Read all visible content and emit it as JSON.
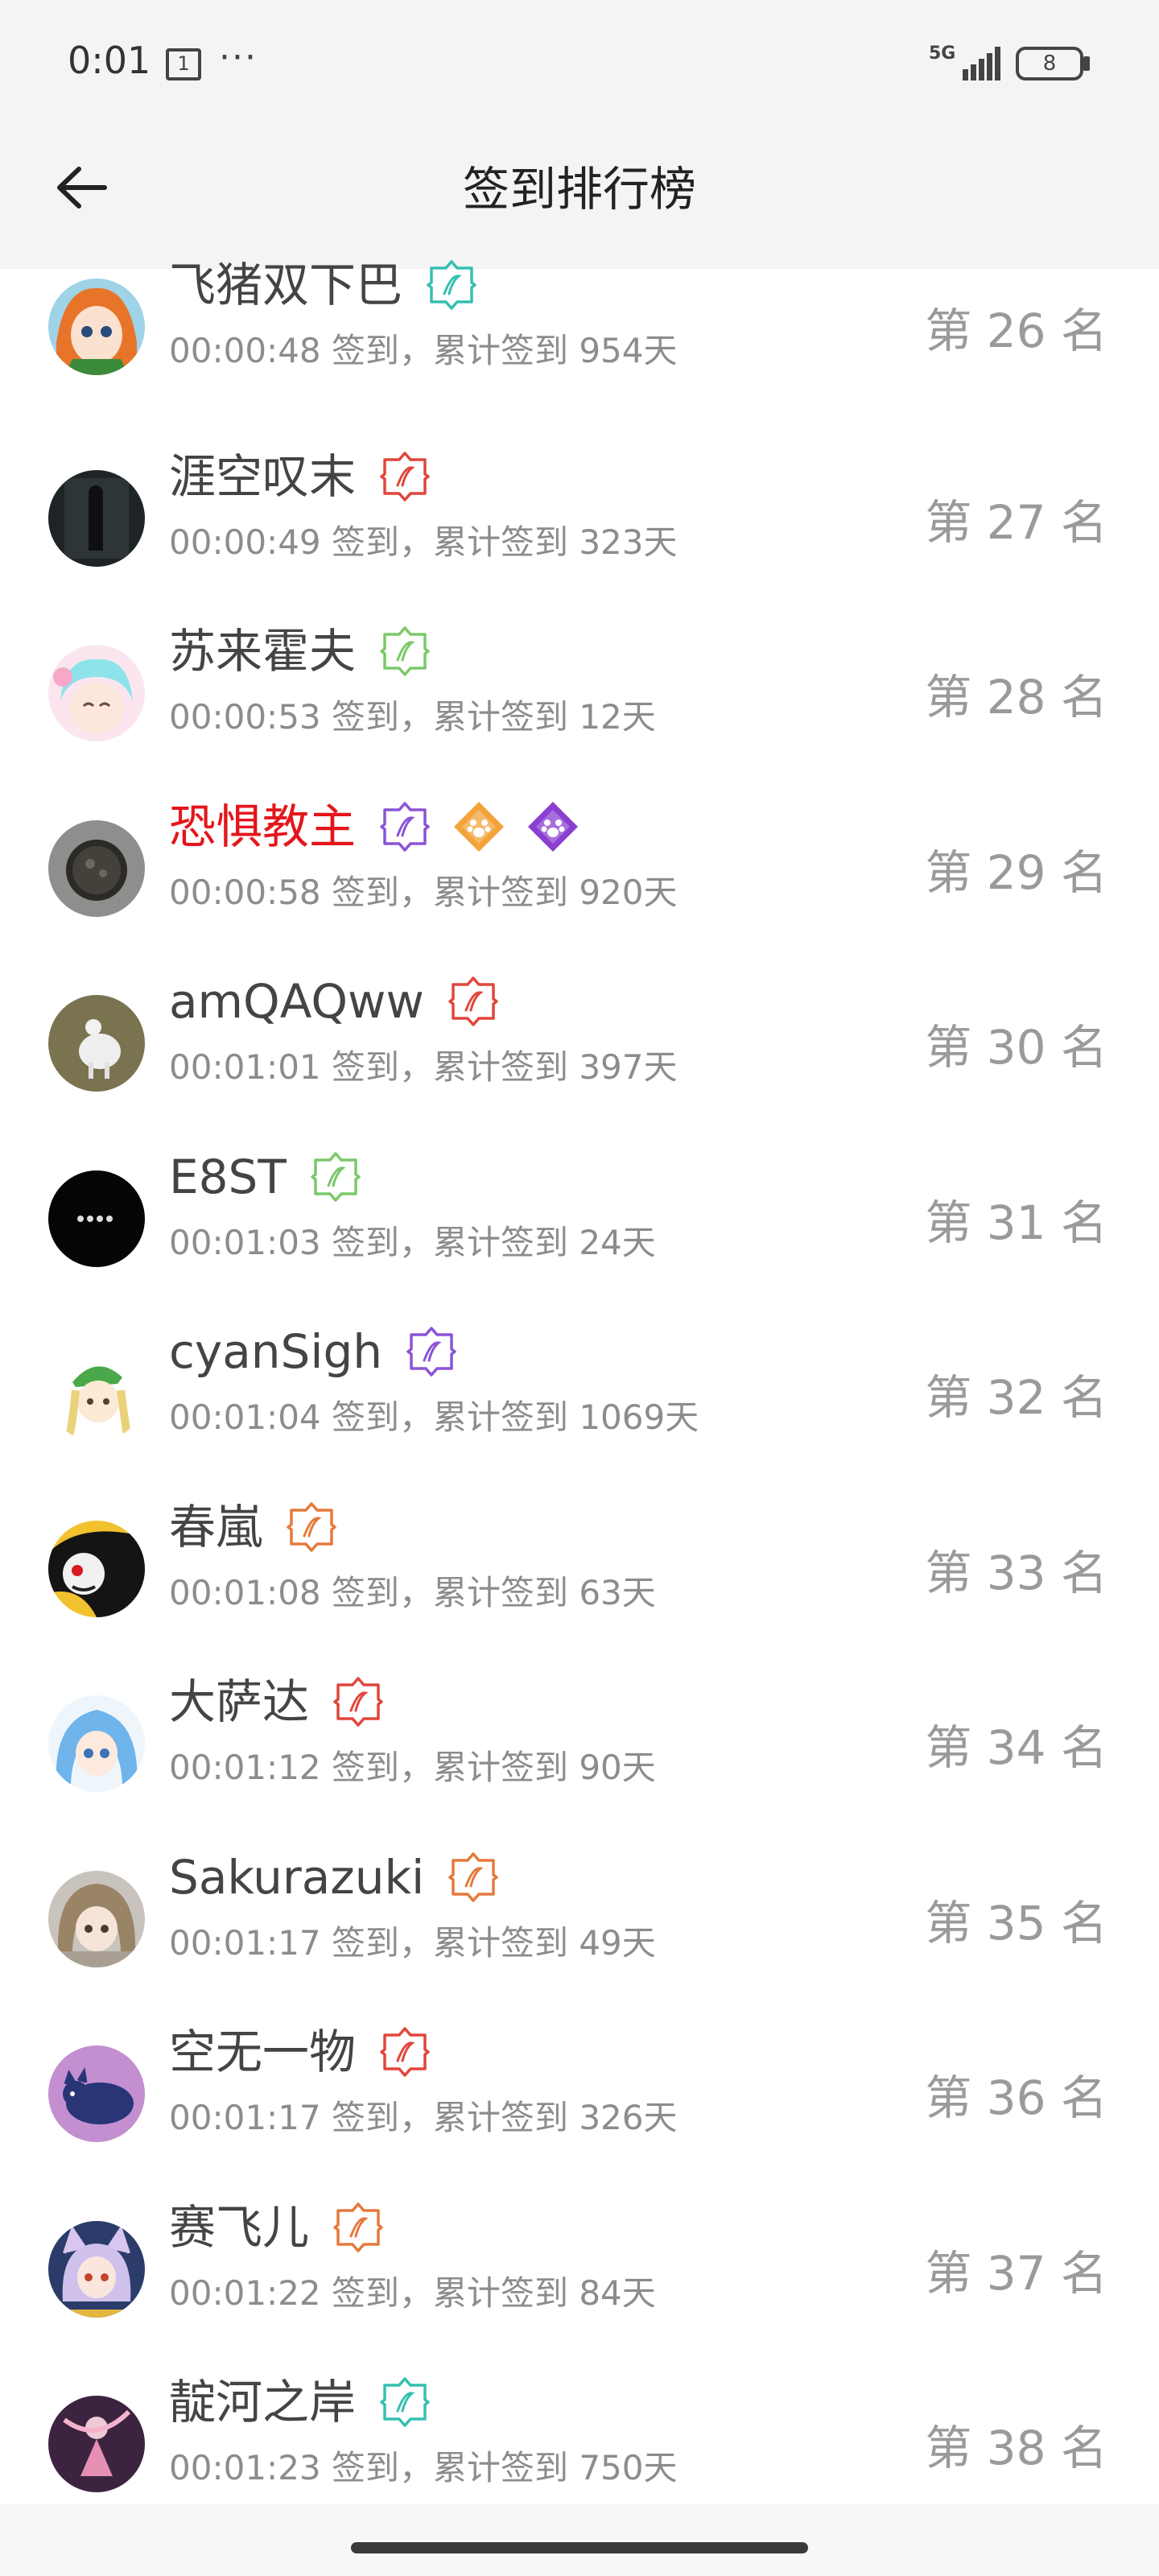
{
  "status_bar": {
    "time": "0:01",
    "sim": "1",
    "more": "···",
    "network": "5G",
    "battery": "8"
  },
  "header": {
    "title": "签到排行榜"
  },
  "colors": {
    "vip_name": "#e4161b",
    "badge_teal": "#36bfb0",
    "badge_red": "#e0463c",
    "badge_green": "#7bc86a",
    "badge_purple": "#8a54d6",
    "badge_orange": "#e57a3c"
  },
  "rows": [
    {
      "name": "飞猪双下巴",
      "sub": "00:00:48 签到，累计签到 954天",
      "rank": "第 26 名",
      "badges": [
        "teal"
      ],
      "avatar": "anime-girl"
    },
    {
      "name": "涯空叹末",
      "sub": "00:00:49 签到，累计签到 323天",
      "rank": "第 27 名",
      "badges": [
        "red"
      ],
      "avatar": "dark-figure"
    },
    {
      "name": "苏来霍夫",
      "sub": "00:00:53 签到，累计签到 12天",
      "rank": "第 28 名",
      "badges": [
        "green"
      ],
      "avatar": "pink-anime"
    },
    {
      "name": "恐惧教主",
      "sub": "00:00:58 签到，累计签到 920天",
      "rank": "第 29 名",
      "badges": [
        "purple",
        "paw-orange",
        "paw-purple"
      ],
      "avatar": "dark-sphere",
      "vip": true
    },
    {
      "name": "amQAQww",
      "sub": "00:01:01 签到，累计签到 397天",
      "rank": "第 30 名",
      "badges": [
        "red"
      ],
      "avatar": "white-creature"
    },
    {
      "name": "E8ST",
      "sub": "00:01:03 签到，累计签到 24天",
      "rank": "第 31 名",
      "badges": [
        "green"
      ],
      "avatar": "black-dots"
    },
    {
      "name": "cyanSigh",
      "sub": "00:01:04 签到，累计签到 1069天",
      "rank": "第 32 名",
      "badges": [
        "purple"
      ],
      "avatar": "chibi-green-hat"
    },
    {
      "name": "春嵐",
      "sub": "00:01:08 签到，累计签到 63天",
      "rank": "第 33 名",
      "badges": [
        "orange"
      ],
      "avatar": "black-red-mask"
    },
    {
      "name": "大萨达",
      "sub": "00:01:12 签到，累计签到 90天",
      "rank": "第 34 名",
      "badges": [
        "red"
      ],
      "avatar": "blue-hair-anime"
    },
    {
      "name": "Sakurazuki",
      "sub": "00:01:17 签到，累计签到 49天",
      "rank": "第 35 名",
      "badges": [
        "orange"
      ],
      "avatar": "brown-hair-anime"
    },
    {
      "name": "空无一物",
      "sub": "00:01:17 签到，累计签到 326天",
      "rank": "第 36 名",
      "badges": [
        "red"
      ],
      "avatar": "purple-cat"
    },
    {
      "name": "赛飞儿",
      "sub": "00:01:22 签到，累计签到 84天",
      "rank": "第 37 名",
      "badges": [
        "orange"
      ],
      "avatar": "cat-ear-girl"
    },
    {
      "name": "靛河之岸",
      "sub": "00:01:23 签到，累计签到 750天",
      "rank": "第 38 名",
      "badges": [
        "teal"
      ],
      "avatar": "pink-dancer"
    }
  ]
}
